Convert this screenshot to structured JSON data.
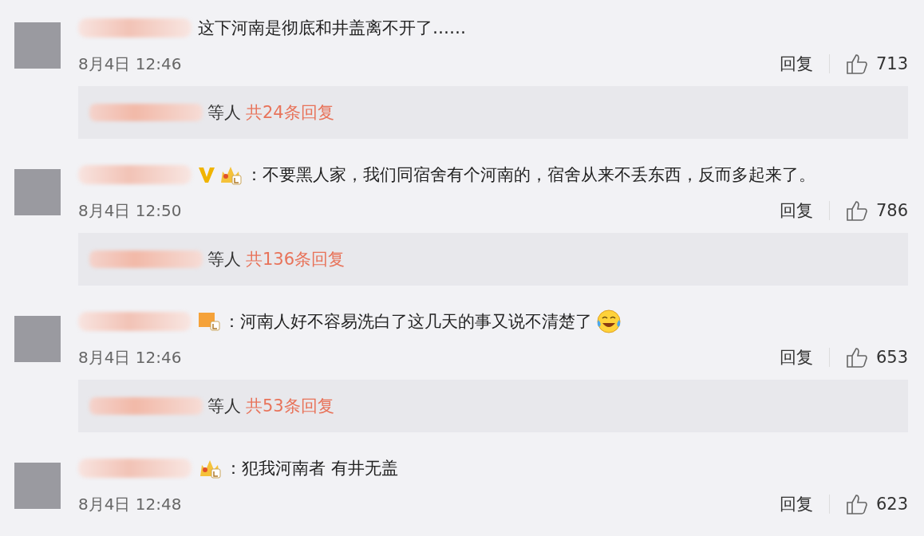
{
  "comments": [
    {
      "text": "这下河南是彻底和井盖离不开了……",
      "time": "8月4日 12:46",
      "reply_label": "回复",
      "likes": "713",
      "summary": {
        "suffix": "等人",
        "count": "共24条回复"
      }
    },
    {
      "badges": [
        {
          "kind": "verified"
        },
        {
          "kind": "crown"
        }
      ],
      "text": "：不要黑人家，我们同宿舍有个河南的，宿舍从来不丢东西，反而多起来了。",
      "time": "8月4日 12:50",
      "reply_label": "回复",
      "likes": "786",
      "summary": {
        "suffix": "等人",
        "count": "共136条回复"
      }
    },
    {
      "badges": [
        {
          "kind": "square"
        }
      ],
      "text": "：河南人好不容易洗白了这几天的事又说不清楚了",
      "trailing_emoji": true,
      "time": "8月4日 12:46",
      "reply_label": "回复",
      "likes": "653",
      "summary": {
        "suffix": "等人",
        "count": "共53条回复"
      }
    },
    {
      "badges": [
        {
          "kind": "crown"
        }
      ],
      "text": "：犯我河南者 有井无盖",
      "time": "8月4日 12:48",
      "reply_label": "回复",
      "likes": "623"
    }
  ]
}
